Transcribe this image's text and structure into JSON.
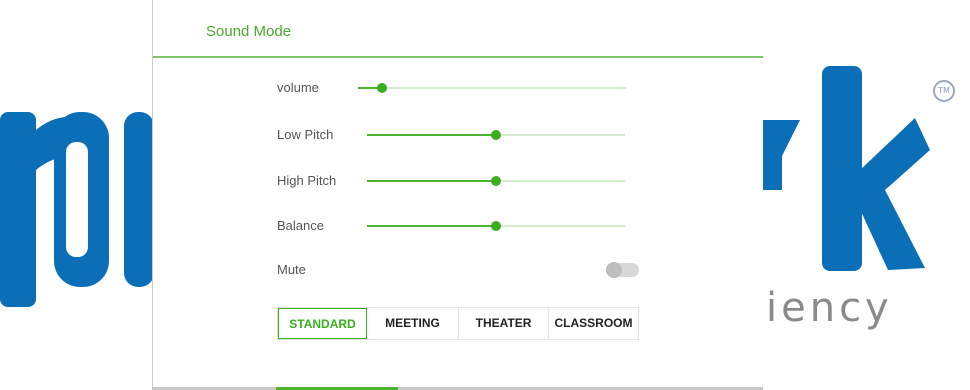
{
  "background": {
    "tagline_fragment": "ciency",
    "brand_color": "#0b6fb8"
  },
  "dialog": {
    "title": "Sound Mode",
    "accent_color": "#4cb52f",
    "sliders": [
      {
        "label": "volume",
        "value": 0.09
      },
      {
        "label": "Low Pitch",
        "value": 0.5
      },
      {
        "label": "High Pitch",
        "value": 0.5
      },
      {
        "label": "Balance",
        "value": 0.5
      }
    ],
    "mute": {
      "label": "Mute",
      "on": false
    },
    "modes": [
      {
        "label": "STANDARD",
        "active": true
      },
      {
        "label": "MEETING",
        "active": false
      },
      {
        "label": "THEATER",
        "active": false
      },
      {
        "label": "CLASSROOM",
        "active": false
      }
    ]
  }
}
